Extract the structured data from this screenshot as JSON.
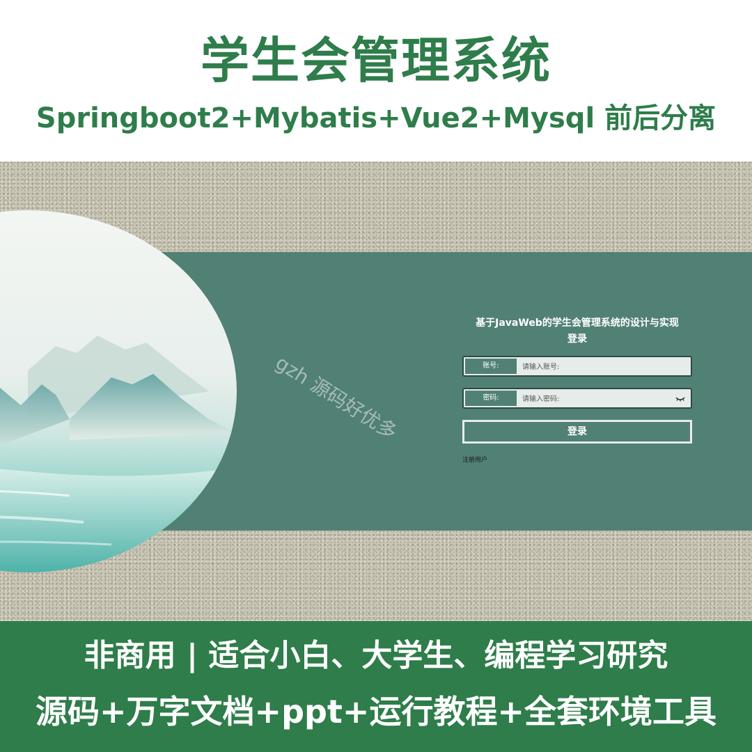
{
  "banner": {
    "title": "学生会管理系统",
    "subtitle": "Springboot2+Mybatis+Vue2+Mysql 前后分离"
  },
  "watermark": "gzh 源码好优多",
  "login": {
    "title": "基于JavaWeb的学生会管理系统的设计与实现",
    "subtitle": "登录",
    "account_label": "账号:",
    "account_placeholder": "请输入账号:",
    "password_label": "密码:",
    "password_placeholder": "请输入密码:",
    "submit_label": "登录",
    "register_link": "注册用户"
  },
  "footer": {
    "line1": "非商用 | 适合小白、大学生、编程学习研究",
    "line2": "源码+万字文档+ppt+运行教程+全套环境工具"
  },
  "colors": {
    "brand_green": "#2e7d4a",
    "panel_teal": "#518075",
    "texture_beige": "#c9c6b6"
  },
  "icons": {
    "password_toggle": "eye-closed-icon"
  }
}
